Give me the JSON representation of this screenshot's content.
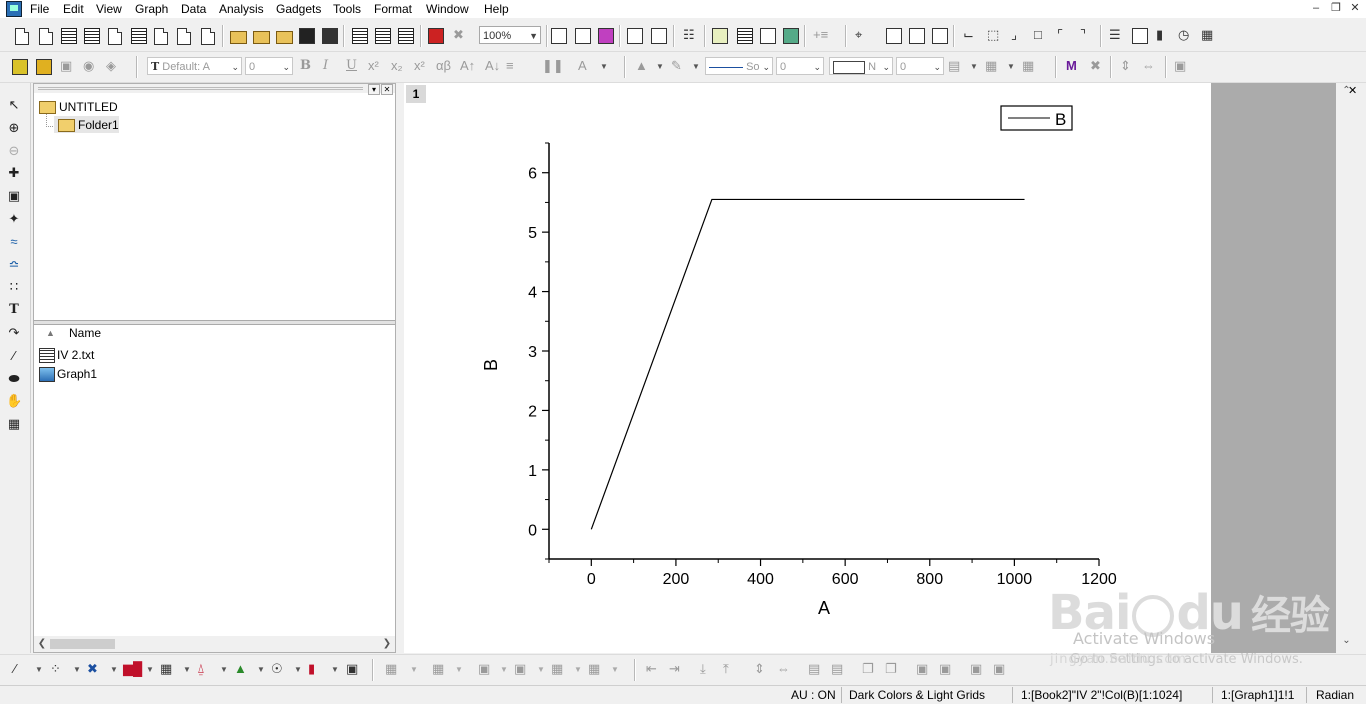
{
  "menu": [
    "File",
    "Edit",
    "View",
    "Graph",
    "Data",
    "Analysis",
    "Gadgets",
    "Tools",
    "Format",
    "Window",
    "Help"
  ],
  "toolbar1": {
    "zoom": "100%"
  },
  "toolbar2": {
    "font_name": "Default: A",
    "font_size": "0",
    "line_style": "So",
    "line_width": "0",
    "fill_color_label": "N",
    "pattern_width": "0"
  },
  "project": {
    "root": "UNTITLED",
    "folder": "Folder1",
    "column_header": "Name",
    "files": [
      {
        "name": "IV 2.txt",
        "icon": "workbook-icon"
      },
      {
        "name": "Graph1",
        "icon": "graph-icon"
      }
    ]
  },
  "graph": {
    "layer_number": "1",
    "legend_label": "B",
    "xlabel": "A",
    "ylabel": "B",
    "xticks": [
      "0",
      "200",
      "400",
      "600",
      "800",
      "1000",
      "1200"
    ],
    "yticks": [
      "0",
      "1",
      "2",
      "3",
      "4",
      "5",
      "6"
    ]
  },
  "chart_data": {
    "type": "line",
    "title": "",
    "xlabel": "A",
    "ylabel": "B",
    "xlim": [
      -100,
      1200
    ],
    "ylim": [
      -0.5,
      6.5
    ],
    "series": [
      {
        "name": "B",
        "x": [
          0,
          285,
          1024
        ],
        "y": [
          0,
          5.55,
          5.55
        ]
      }
    ],
    "legend": "top-right",
    "grid": false
  },
  "status": {
    "au": "AU : ON",
    "theme": "Dark Colors & Light Grids",
    "column": "1:[Book2]\"IV 2\"!Col(B)[1:1024]",
    "graph": "1:[Graph1]1!1",
    "units": "Radian"
  },
  "watermark": {
    "text": "Activate Windows",
    "sub": "Go to Settings to activate Windows.",
    "brand": "Bai",
    "brand2": "du",
    "brand_cn": "经验",
    "url": "jingyan.baidu.com"
  }
}
